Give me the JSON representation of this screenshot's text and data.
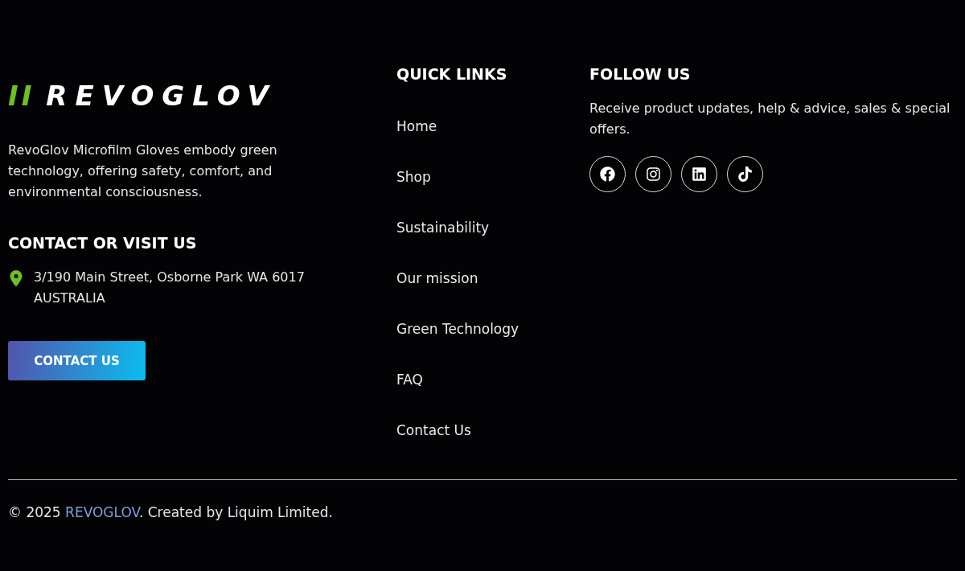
{
  "brand": {
    "mark": "II",
    "name": "REVOGLOV",
    "description": "RevoGlov Microfilm Gloves embody green technology, offering safety, comfort, and environmental consciousness."
  },
  "contact": {
    "heading": "CONTACT OR VISIT US",
    "address": "3/190 Main Street, Osborne Park WA 6017 AUSTRALIA",
    "button": "CONTACT US"
  },
  "quick_links": {
    "heading": "QUICK LINKS",
    "items": [
      "Home",
      "Shop",
      "Sustainability",
      "Our mission",
      "Green Technology",
      "FAQ",
      "Contact Us"
    ]
  },
  "follow": {
    "heading": "FOLLOW US",
    "text": "Receive product updates, help & advice, sales & special offers.",
    "socials": [
      {
        "kind": "facebook"
      },
      {
        "kind": "instagram"
      },
      {
        "kind": "linkedin"
      },
      {
        "kind": "tiktok"
      }
    ]
  },
  "footer": {
    "prefix": "© 2025",
    "link": "REVOGLOV",
    "suffix": ". Created by Liquim Limited."
  }
}
